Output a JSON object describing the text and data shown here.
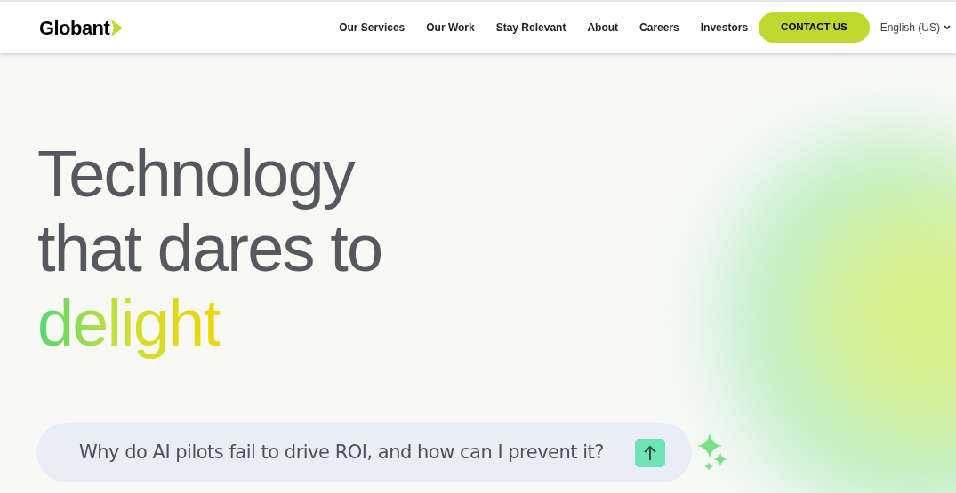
{
  "header": {
    "logo": "Globant",
    "nav": [
      "Our Services",
      "Our Work",
      "Stay Relevant",
      "About",
      "Careers",
      "Investors"
    ],
    "cta": "CONTACT US",
    "language": "English (US)"
  },
  "hero": {
    "headline_lines": [
      "Technology",
      "that dares to"
    ],
    "highlight": "delight"
  },
  "prompt": {
    "value": "Why do AI pilots fail to drive ROI, and how can I prevent it?"
  }
}
